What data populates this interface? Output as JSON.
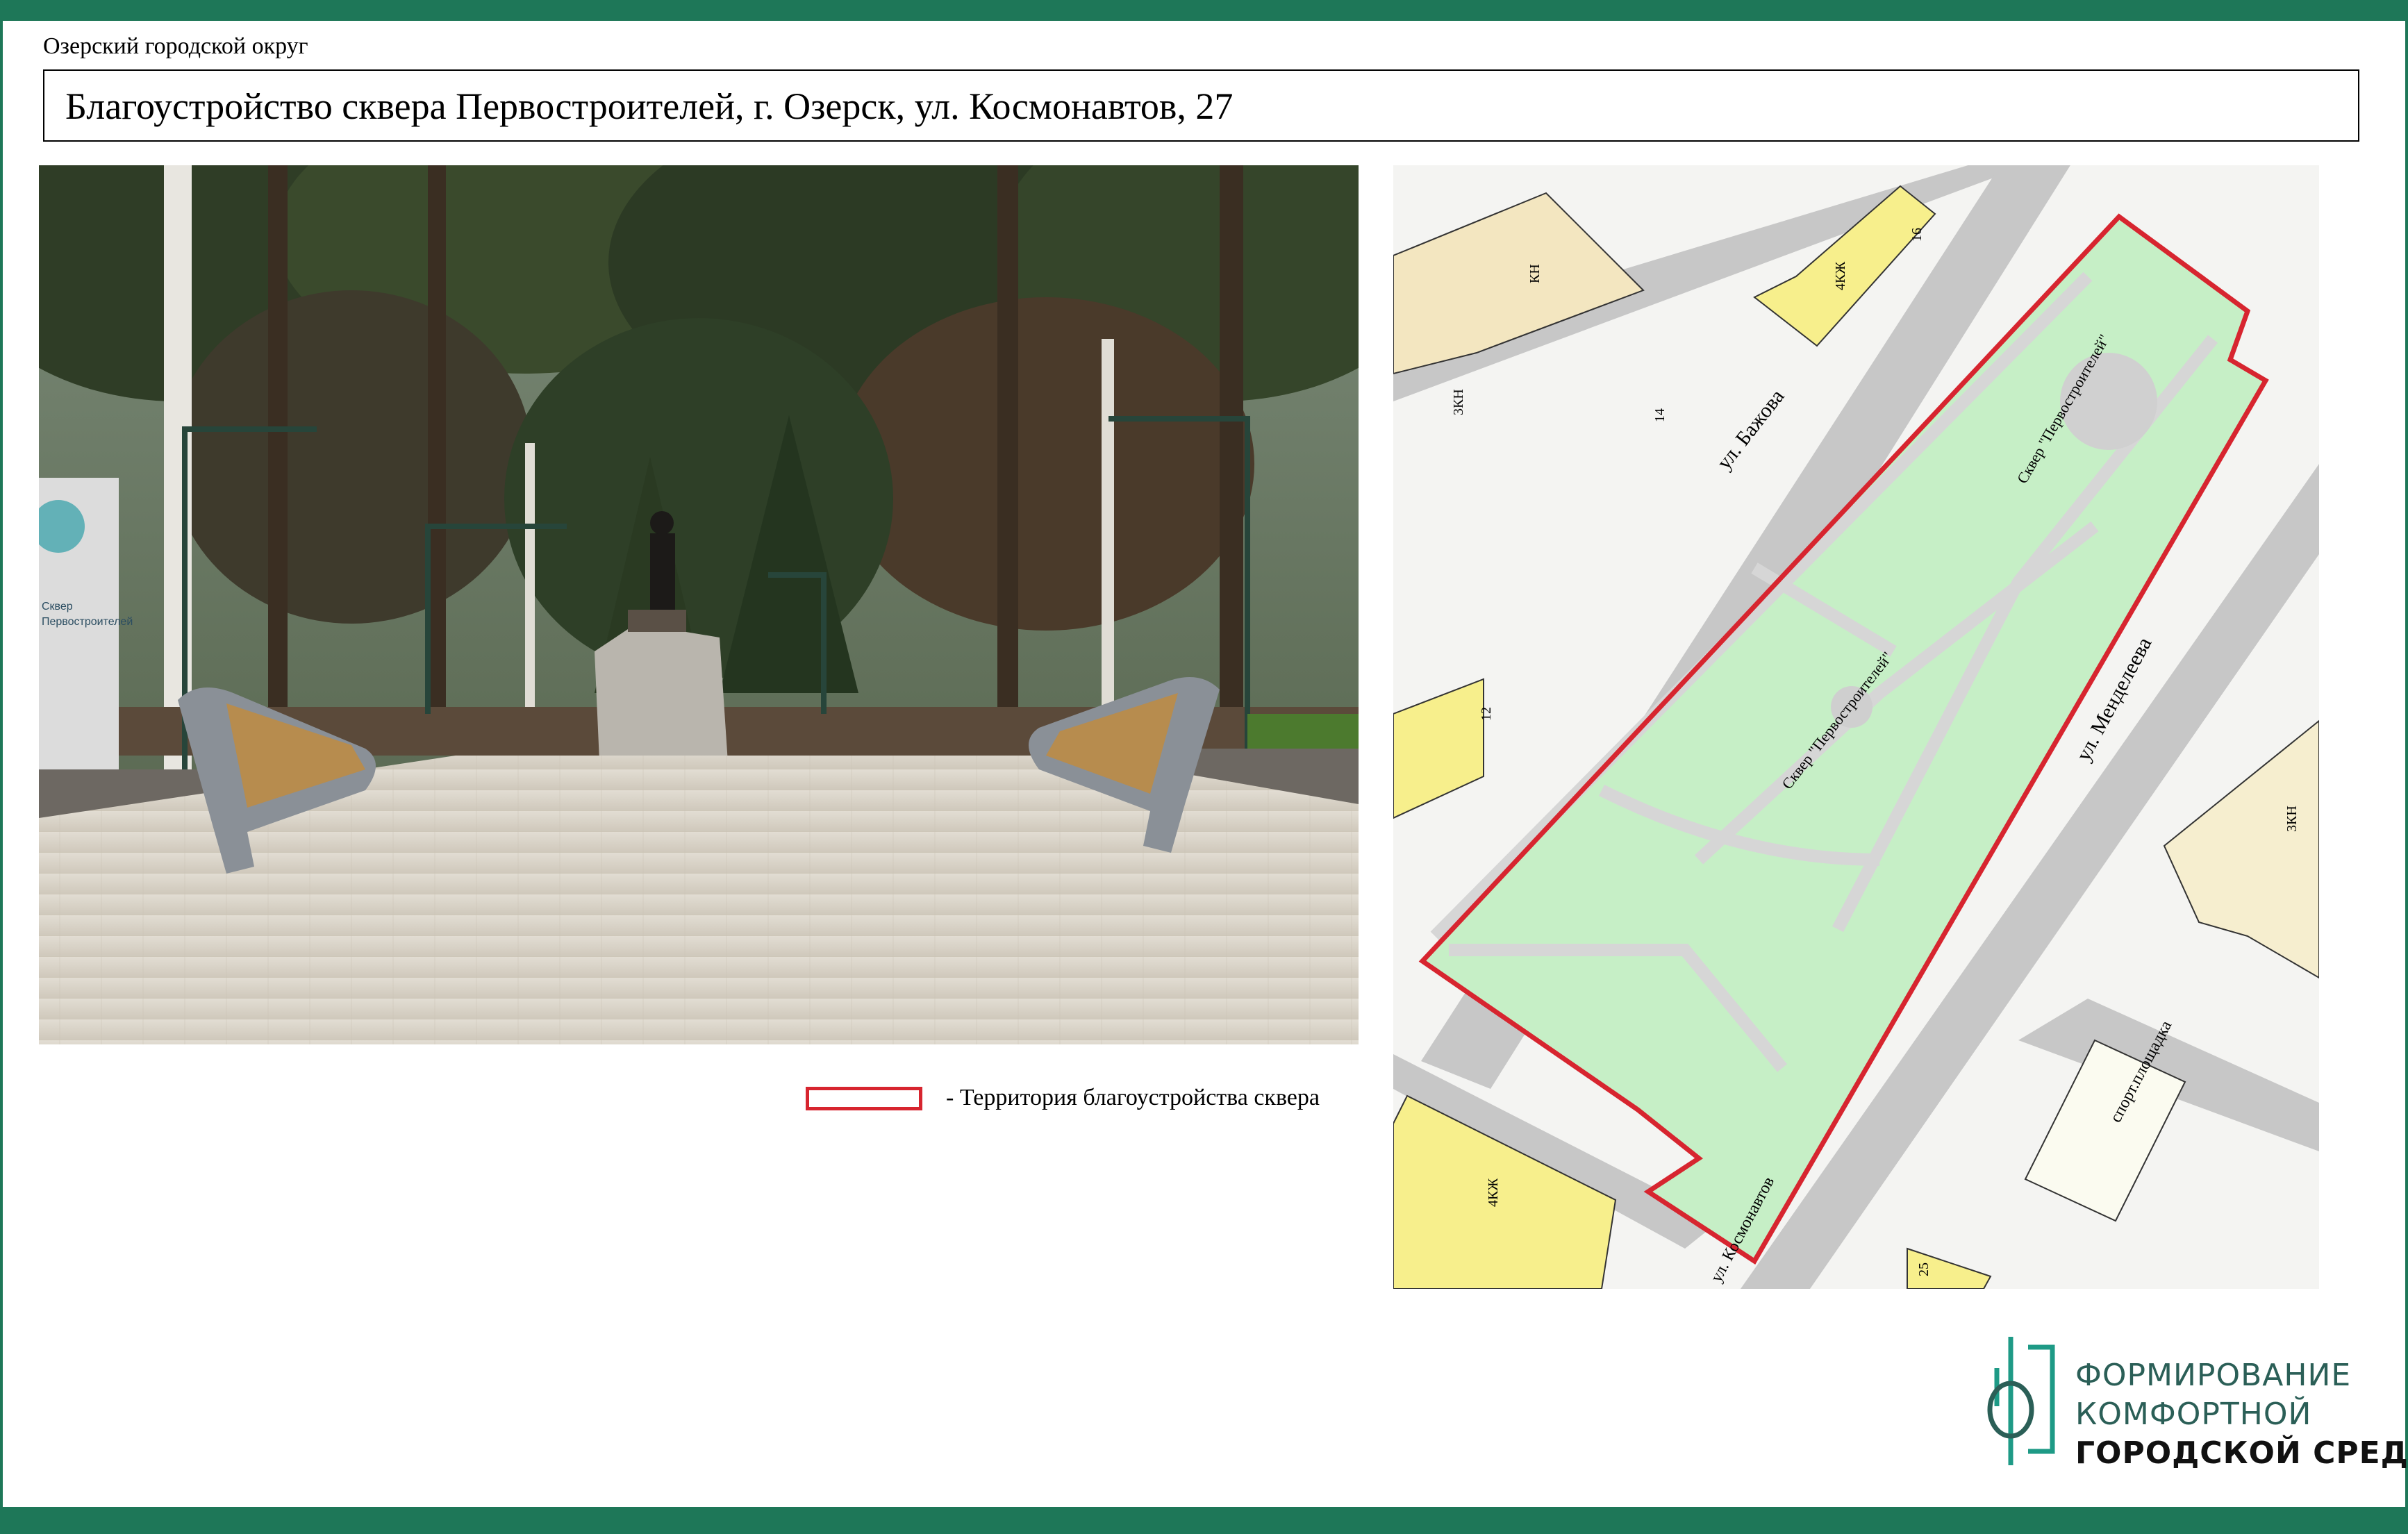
{
  "header": {
    "municipality": "Озерский городской округ",
    "title": "Благоустройство сквера Первостроителей, г. Озерск, ул. Космонавтов, 27"
  },
  "render": {
    "sign_text_1": "Сквер",
    "sign_text_2": "Первостроителей"
  },
  "map": {
    "street_bazhova": "ул. Бажова",
    "street_mendeleeva": "ул. Менделеева",
    "street_kosmonavtov": "ул. Космонавтов",
    "park_label_main": "Сквер \"Первостроителей\"",
    "park_label_top": "Сквер \"Первостроителей\"",
    "sports_ground": "спорт.площадка",
    "bldg_4kzh_top": "4КЖ",
    "bldg_4kzh_bottom": "4КЖ",
    "bldg_kn": "КН",
    "bldg_3kn_left": "3КН",
    "bldg_3kn_right": "3КН",
    "house_16": "16",
    "house_14": "14",
    "house_12": "12",
    "house_25": "25",
    "boundary_color": "#d7252f",
    "park_color": "#c6efc6"
  },
  "legend": {
    "text": "- Территория благоустройства сквера",
    "color": "#d7252f"
  },
  "logo": {
    "line1": "ФОРМИРОВАНИЕ",
    "line2": "КОМФОРТНОЙ",
    "line3": "ГОРОДСКОЙ СРЕДЫ",
    "color": "#1e9a86"
  }
}
